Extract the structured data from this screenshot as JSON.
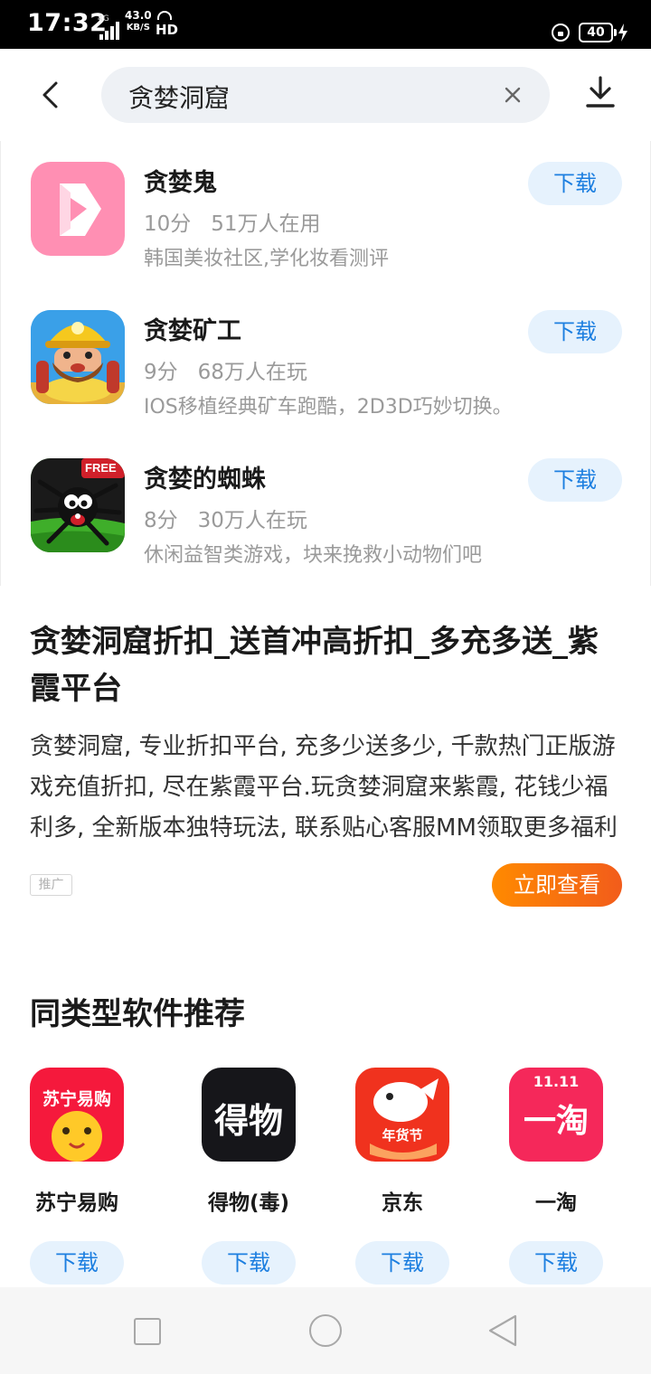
{
  "status_bar": {
    "time": "17:32",
    "network": "4G",
    "speed_value": "43.0",
    "speed_unit": "KB/S",
    "hd_label": "HD",
    "battery": "40"
  },
  "header": {
    "search_query": "贪婪洞窟"
  },
  "apps": [
    {
      "name": "贪婪鬼",
      "score": "10分",
      "users": "51万人在用",
      "desc": "韩国美妆社区,学化妆看测评",
      "button": "下载",
      "icon": "tanlangui-app-icon",
      "icon_color": "#ff8fb3"
    },
    {
      "name": "贪婪矿工",
      "score": "9分",
      "users": "68万人在玩",
      "desc": "IOS移植经典矿车跑酷，2D3D巧妙切换。",
      "button": "下载",
      "icon": "miner-app-icon",
      "icon_color": "#3aa0e8"
    },
    {
      "name": "贪婪的蜘蛛",
      "score": "8分",
      "users": "30万人在玩",
      "desc": "休闲益智类游戏，块来挽救小动物们吧",
      "button": "下载",
      "icon": "spider-app-icon",
      "icon_badge": "FREE",
      "icon_color": "#2f9d1f"
    }
  ],
  "ad": {
    "title": "贪婪洞窟折扣_送首冲高折扣_多充多送_紫霞平台",
    "body": "贪婪洞窟, 专业折扣平台, 充多少送多少, 千款热门正版游戏充值折扣, 尽在紫霞平台.玩贪婪洞窟来紫霞, 花钱少福利多, 全新版本独特玩法, 联系贴心客服MM领取更多福利",
    "tag": "推广",
    "cta": "立即查看",
    "cta_color": "#f5701a"
  },
  "recommendations": {
    "title": "同类型软件推荐",
    "items": [
      {
        "name": "苏宁易购",
        "button": "下载",
        "icon": "suning-app-icon",
        "icon_text": "苏宁易购",
        "icon_color": "#f5193c"
      },
      {
        "name": "得物(毒)",
        "button": "下载",
        "icon": "dewu-app-icon",
        "icon_text": "得物",
        "icon_color": "#16161a"
      },
      {
        "name": "京东",
        "button": "下载",
        "icon": "jd-app-icon",
        "icon_text": "年货节",
        "icon_color": "#f0321e"
      },
      {
        "name": "一淘",
        "button": "下载",
        "icon": "yitao-app-icon",
        "icon_top": "11.11",
        "icon_text": "一淘",
        "icon_color": "#f5285a"
      }
    ]
  },
  "colors": {
    "accent_blue": "#1d7fe0",
    "button_bg": "#e6f2fd",
    "muted_text": "#9a9a9a"
  }
}
